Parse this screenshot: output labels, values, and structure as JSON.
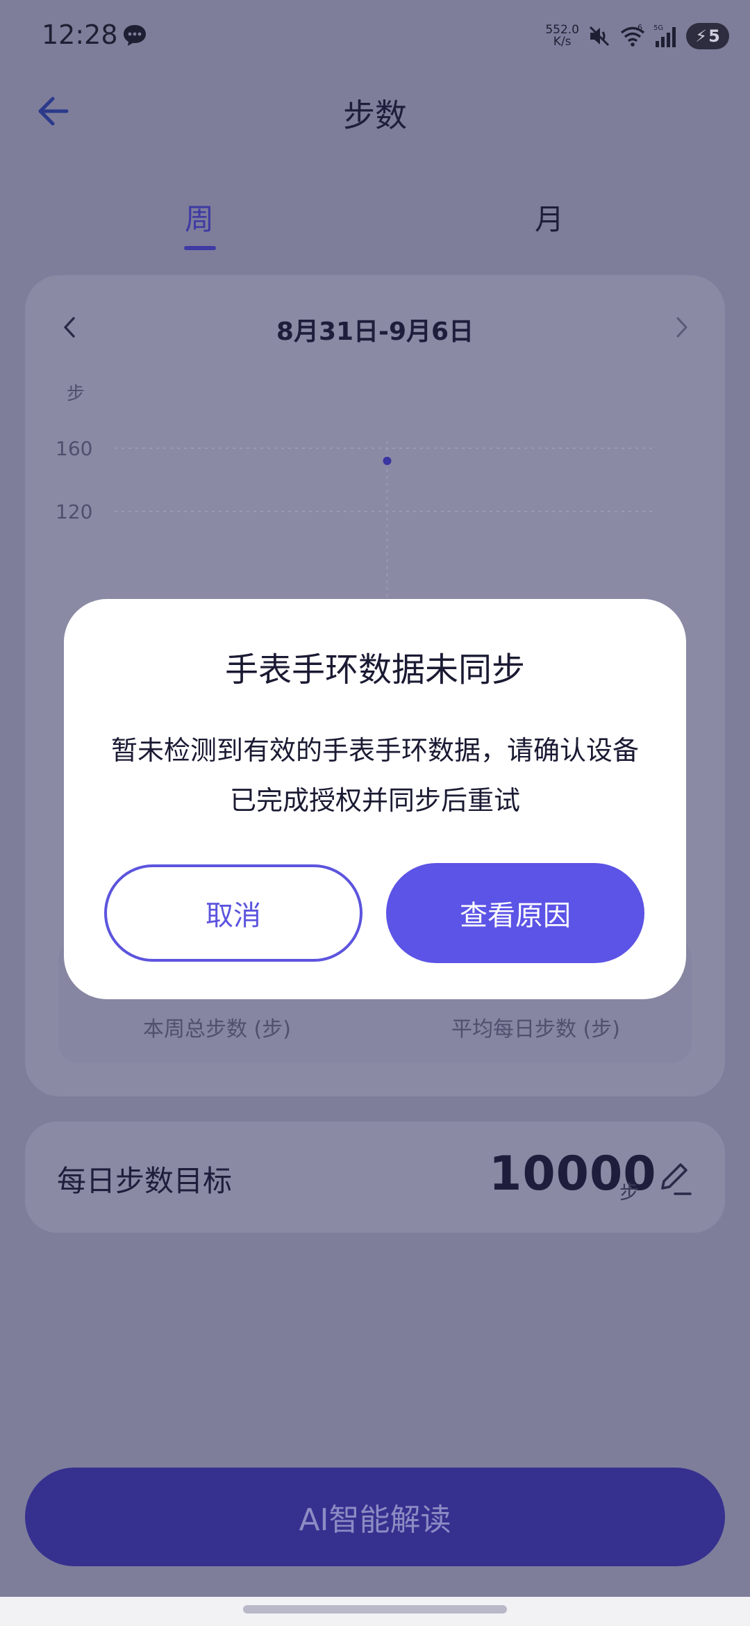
{
  "status_bar": {
    "time": "12:28",
    "net_speed_value": "552.0",
    "net_speed_unit": "K/s",
    "wifi_label": "6",
    "signal_label": "5G",
    "battery_level": "5"
  },
  "header": {
    "title": "步数"
  },
  "tabs": [
    {
      "label": "周",
      "active": true
    },
    {
      "label": "月",
      "active": false
    }
  ],
  "date_range": "8月31日-9月6日",
  "chart_data": {
    "type": "scatter",
    "ylabel": "步",
    "yticks": [
      160,
      120
    ],
    "ylim": [
      0,
      160
    ],
    "points": [
      {
        "x": 4,
        "y": 152
      }
    ],
    "x_count": 7,
    "grid": true
  },
  "stats": {
    "total_label": "本周总步数 (步)",
    "avg_label": "平均每日步数 (步)"
  },
  "goal": {
    "label": "每日步数目标",
    "value": "10000",
    "unit": "步"
  },
  "ai_button": {
    "label": "AI智能解读"
  },
  "dialog": {
    "title": "手表手环数据未同步",
    "message": "暂未检测到有效的手表手环数据，请确认设备已完成授权并同步后重试",
    "cancel_label": "取消",
    "confirm_label": "查看原因"
  },
  "colors": {
    "accent": "#5c54e6",
    "overlay": "#7e7e9b",
    "dialog_bg": "#ffffff"
  }
}
